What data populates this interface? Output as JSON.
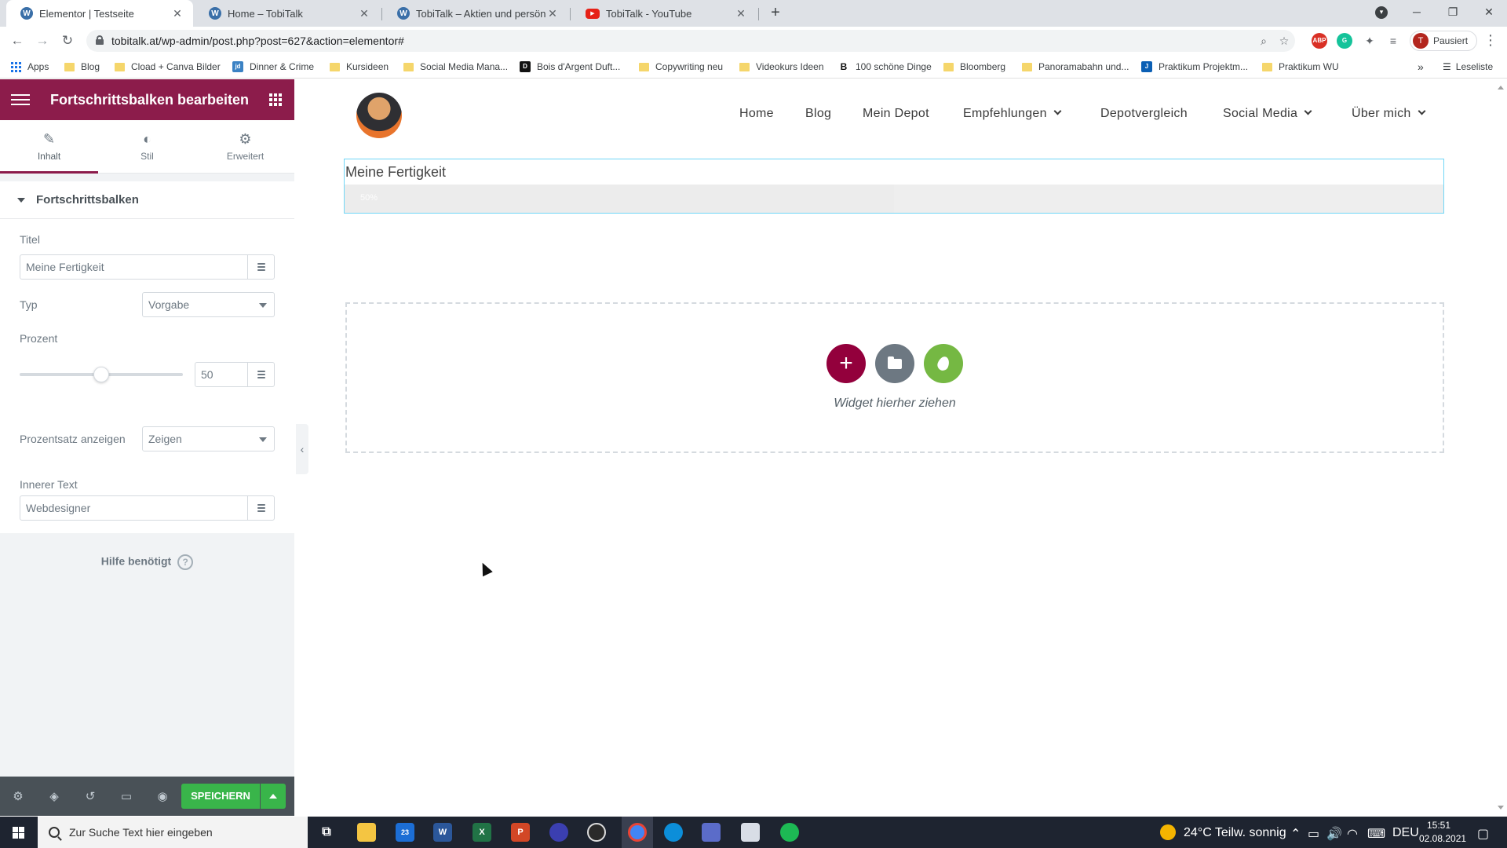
{
  "browser": {
    "tabs": [
      {
        "title": "Elementor | Testseite",
        "icon": "wordpress-icon",
        "active": true
      },
      {
        "title": "Home – TobiTalk",
        "icon": "wordpress-icon",
        "active": false
      },
      {
        "title": "TobiTalk – Aktien und persönliche",
        "icon": "wordpress-icon",
        "active": false
      },
      {
        "title": "TobiTalk - YouTube",
        "icon": "youtube-icon",
        "active": false
      }
    ],
    "url": "tobitalk.at/wp-admin/post.php?post=627&action=elementor#",
    "profile_label": "Pausiert",
    "profile_initial": "T",
    "bookmarks": [
      "Apps",
      "Blog",
      "Cload + Canva Bilder",
      "Dinner & Crime",
      "Kursideen",
      "Social Media Mana...",
      "Bois d'Argent Duft...",
      "Copywriting neu",
      "Videokurs Ideen",
      "100 schöne Dinge",
      "Bloomberg",
      "Panoramabahn und...",
      "Praktikum Projektm...",
      "Praktikum WU"
    ],
    "reading_list": "Leseliste"
  },
  "panel": {
    "title": "Fortschrittsbalken bearbeiten",
    "tabs": [
      {
        "label": "Inhalt",
        "icon": "pencil-icon",
        "active": true
      },
      {
        "label": "Stil",
        "icon": "half-circle-icon",
        "active": false
      },
      {
        "label": "Erweitert",
        "icon": "gear-icon",
        "active": false
      }
    ],
    "section_title": "Fortschrittsbalken",
    "controls": {
      "title_label": "Titel",
      "title_value": "Meine Fertigkeit",
      "type_label": "Typ",
      "type_value": "Vorgabe",
      "percent_label": "Prozent",
      "percent_value": "50",
      "show_percent_label": "Prozentsatz anzeigen",
      "show_percent_value": "Zeigen",
      "inner_text_label": "Innerer Text",
      "inner_text_value": "Webdesigner"
    },
    "help_text": "Hilfe benötigt",
    "save_label": "SPEICHERN"
  },
  "site": {
    "nav": [
      "Home",
      "Blog",
      "Mein Depot",
      "Empfehlungen",
      "Depotvergleich",
      "Social Media",
      "Über mich"
    ],
    "progress": {
      "title": "Meine Fertigkeit",
      "percent": 50,
      "percent_text": "50%"
    },
    "drop_zone_text": "Widget hierher ziehen",
    "colors": {
      "elementor_brand": "#93003c",
      "template_button": "#6d7882",
      "kit_button": "#75b843",
      "save_button": "#39b54a"
    }
  },
  "taskbar": {
    "search_placeholder": "Zur Suche Text hier eingeben",
    "mail_badge": "23",
    "weather": "24°C  Teilw. sonnig",
    "language": "DEU",
    "time": "15:51",
    "date": "02.08.2021"
  }
}
